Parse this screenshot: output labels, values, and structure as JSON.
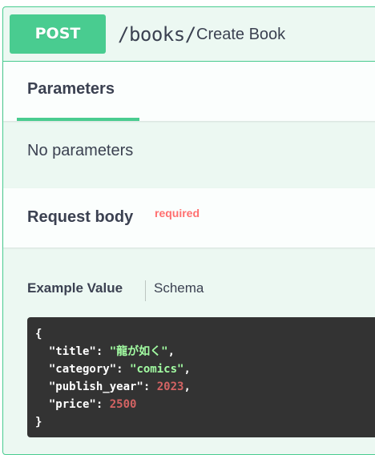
{
  "operation": {
    "method": "POST",
    "path": "/books/",
    "summary": "Create Book"
  },
  "parameters": {
    "tab_label": "Parameters",
    "empty_text": "No parameters"
  },
  "request_body": {
    "title": "Request body",
    "required_label": "required",
    "tabs": {
      "example": "Example Value",
      "schema": "Schema"
    },
    "example": {
      "open_brace": "{",
      "close_brace": "}",
      "fields": [
        {
          "key": "\"title\"",
          "value": "\"龍が如く\"",
          "type": "string",
          "comma": ","
        },
        {
          "key": "\"category\"",
          "value": "\"comics\"",
          "type": "string",
          "comma": ","
        },
        {
          "key": "\"publish_year\"",
          "value": "2023",
          "type": "number",
          "comma": ","
        },
        {
          "key": "\"price\"",
          "value": "2500",
          "type": "number",
          "comma": ""
        }
      ]
    }
  },
  "colors": {
    "post_accent": "#49cc90",
    "block_background": "#ecf8f2",
    "required": "#ff6f6f",
    "code_background": "#333333",
    "code_string": "#a2fca2",
    "code_number": "#d36363"
  }
}
